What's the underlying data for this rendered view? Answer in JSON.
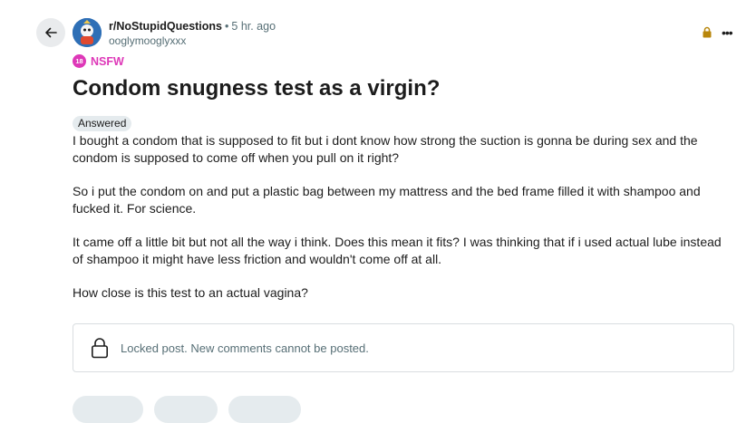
{
  "post": {
    "subreddit": "r/NoStupidQuestions",
    "separator": "•",
    "time": "5 hr. ago",
    "username": "ooglymooglyxxx",
    "nsfw_badge": "18",
    "nsfw_label": "NSFW",
    "title": "Condom snugness test as a virgin?",
    "flair": "Answered",
    "body": [
      "I bought a condom that is supposed to fit but i dont know how strong the suction is gonna be during sex and the condom is supposed to come off when you pull on it right?",
      "So i put the condom on and put a plastic bag between my mattress and the bed frame filled it with shampoo and fucked it. For science.",
      "It came off a little bit but not all the way i think. Does this mean it fits? I was thinking that if i used actual lube instead of shampoo it might have less friction and wouldn't come off at all.",
      "How close is this test to an actual vagina?"
    ],
    "locked_message": "Locked post. New comments cannot be posted."
  },
  "toolbar": {
    "more_label": "•••"
  },
  "icons": {
    "back": "arrow-left-icon",
    "avatar": "subreddit-avatar",
    "lock": "lock-icon",
    "more": "more-horizontal-icon"
  },
  "colors": {
    "nsfw": "#de38b8",
    "lock_gold": "#b8860b",
    "meta_gray": "#576f76",
    "flair_bg": "#e5ebee"
  }
}
